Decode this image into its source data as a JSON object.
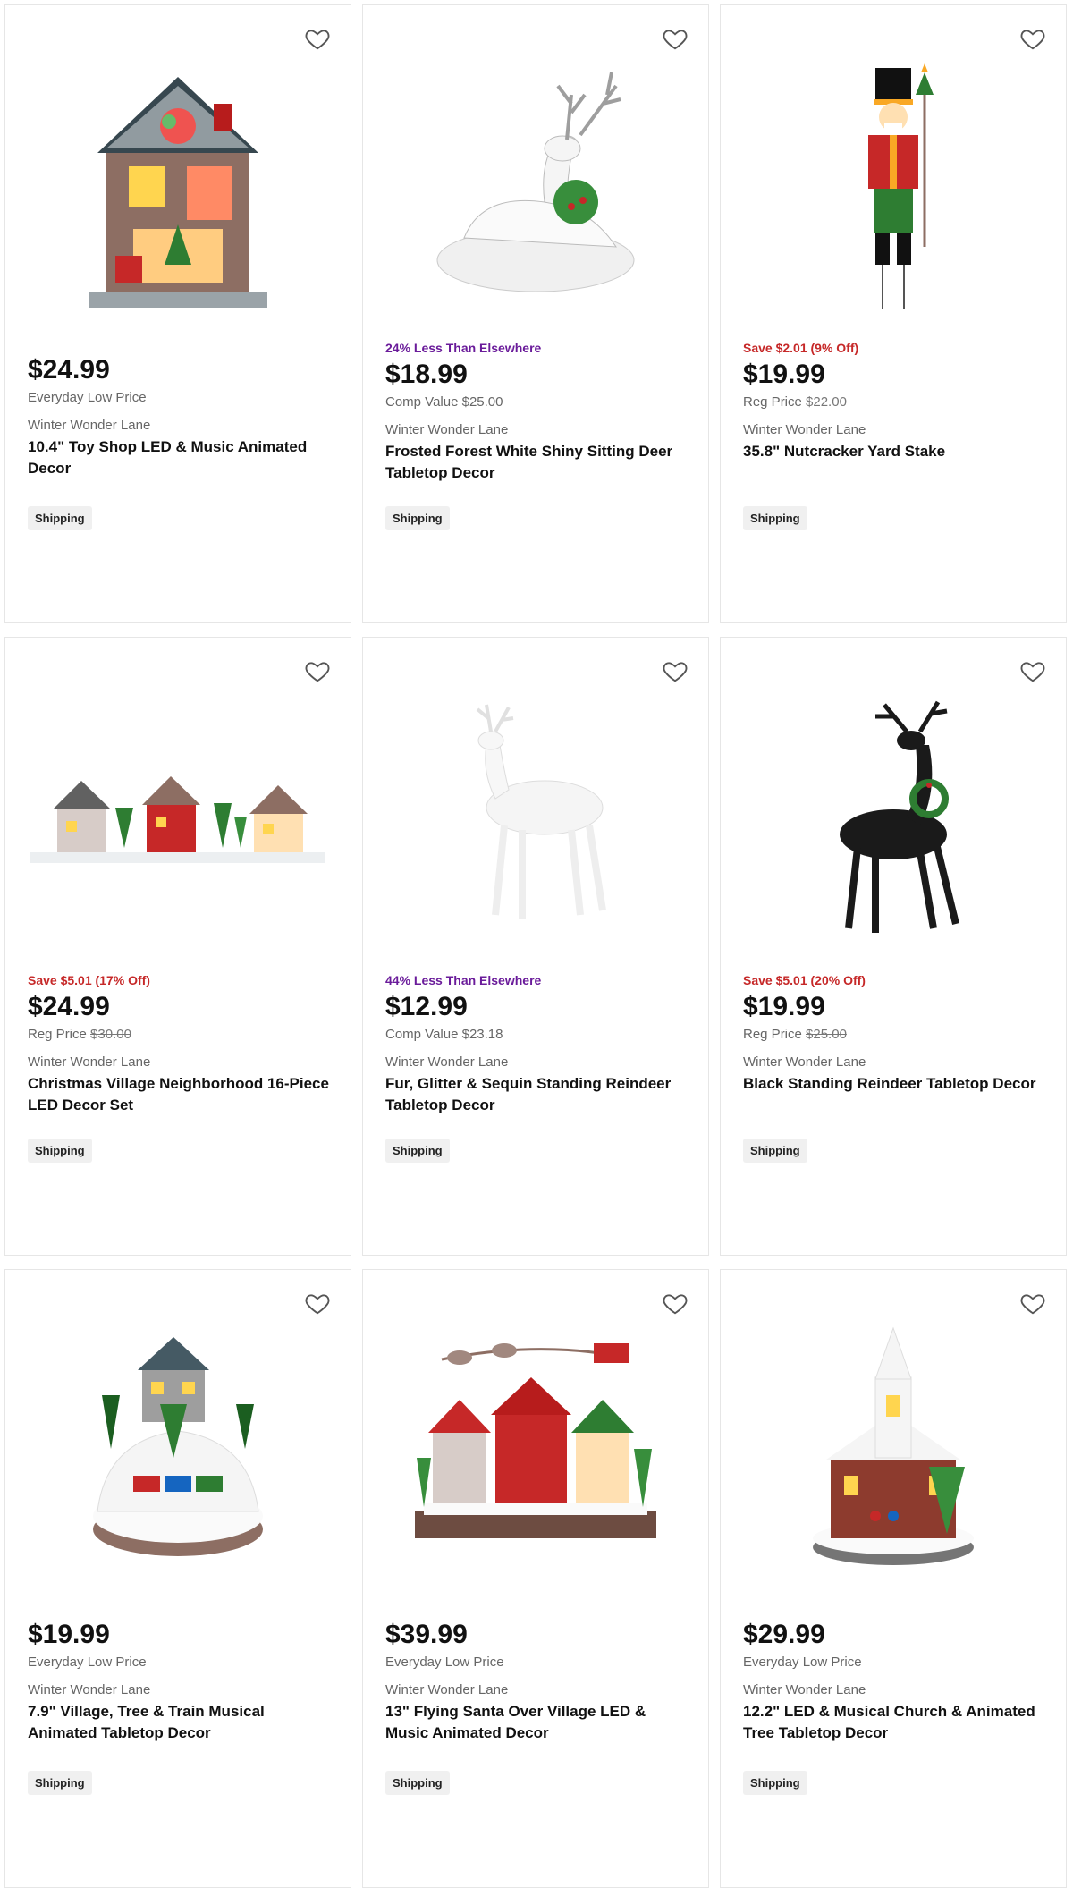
{
  "products": [
    {
      "promo": "",
      "promo_color": "",
      "price": "$24.99",
      "sub_label": "Everyday Low Price",
      "sub_value": "",
      "brand": "Winter Wonder Lane",
      "title": "10.4\" Toy Shop LED & Music Animated Decor",
      "shipping": "Shipping",
      "icon": "toy-shop-image"
    },
    {
      "promo": "24% Less Than Elsewhere",
      "promo_color": "#6a1b9a",
      "price": "$18.99",
      "sub_label": "Comp Value $25.00",
      "sub_value": "",
      "brand": "Winter Wonder Lane",
      "title": "Frosted Forest White Shiny Sitting Deer Tabletop Decor",
      "shipping": "Shipping",
      "icon": "sitting-deer-image"
    },
    {
      "promo": "Save $2.01 (9% Off)",
      "promo_color": "#c62828",
      "price": "$19.99",
      "sub_label": "Reg Price",
      "sub_value": "$22.00",
      "brand": "Winter Wonder Lane",
      "title": "35.8\" Nutcracker Yard Stake",
      "shipping": "Shipping",
      "icon": "nutcracker-image"
    },
    {
      "promo": "Save $5.01 (17% Off)",
      "promo_color": "#c62828",
      "price": "$24.99",
      "sub_label": "Reg Price",
      "sub_value": "$30.00",
      "brand": "Winter Wonder Lane",
      "title": "Christmas Village Neighborhood 16-Piece LED Decor Set",
      "shipping": "Shipping",
      "icon": "village-set-image"
    },
    {
      "promo": "44% Less Than Elsewhere",
      "promo_color": "#6a1b9a",
      "price": "$12.99",
      "sub_label": "Comp Value $23.18",
      "sub_value": "",
      "brand": "Winter Wonder Lane",
      "title": "Fur, Glitter & Sequin Standing Reindeer Tabletop Decor",
      "shipping": "Shipping",
      "icon": "white-reindeer-image"
    },
    {
      "promo": "Save $5.01 (20% Off)",
      "promo_color": "#c62828",
      "price": "$19.99",
      "sub_label": "Reg Price",
      "sub_value": "$25.00",
      "brand": "Winter Wonder Lane",
      "title": "Black Standing Reindeer Tabletop Decor",
      "shipping": "Shipping",
      "icon": "black-reindeer-image"
    },
    {
      "promo": "",
      "promo_color": "",
      "price": "$19.99",
      "sub_label": "Everyday Low Price",
      "sub_value": "",
      "brand": "Winter Wonder Lane",
      "title": "7.9\" Village, Tree & Train Musical Animated Tabletop Decor",
      "shipping": "Shipping",
      "icon": "village-train-image"
    },
    {
      "promo": "",
      "promo_color": "",
      "price": "$39.99",
      "sub_label": "Everyday Low Price",
      "sub_value": "",
      "brand": "Winter Wonder Lane",
      "title": "13\" Flying Santa Over Village LED & Music Animated Decor",
      "shipping": "Shipping",
      "icon": "flying-santa-village-image"
    },
    {
      "promo": "",
      "promo_color": "",
      "price": "$29.99",
      "sub_label": "Everyday Low Price",
      "sub_value": "",
      "brand": "Winter Wonder Lane",
      "title": "12.2\" LED & Musical Church & Animated Tree Tabletop Decor",
      "shipping": "Shipping",
      "icon": "church-image"
    }
  ]
}
